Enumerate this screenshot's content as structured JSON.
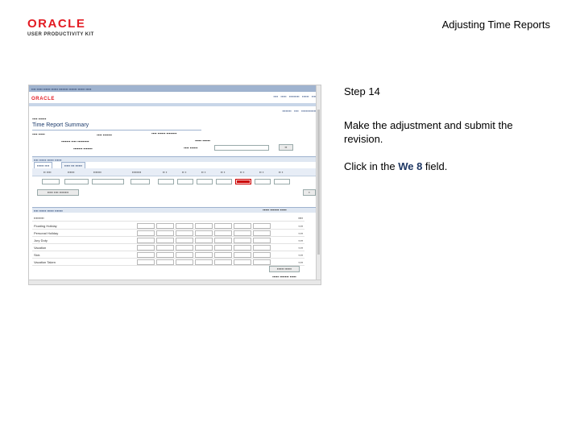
{
  "branding": {
    "logo_text": "ORACLE",
    "logo_subtext": "USER PRODUCTIVITY KIT"
  },
  "document_title": "Adjusting Time Reports",
  "step": {
    "label": "Step 14",
    "instruction": "Make the adjustment and submit the revision.",
    "click_prefix": "Click in the ",
    "click_field": "We 8",
    "click_suffix": " field."
  },
  "screenshot": {
    "app_brand": "ORACLE",
    "page_title": "Time Report Summary",
    "summary_rows": [
      "Floating Holiday",
      "Personal Holiday",
      "Jury Duty",
      "Vacation",
      "Sick",
      "Vacation Taken"
    ],
    "highlight_color": "#cc0000"
  }
}
